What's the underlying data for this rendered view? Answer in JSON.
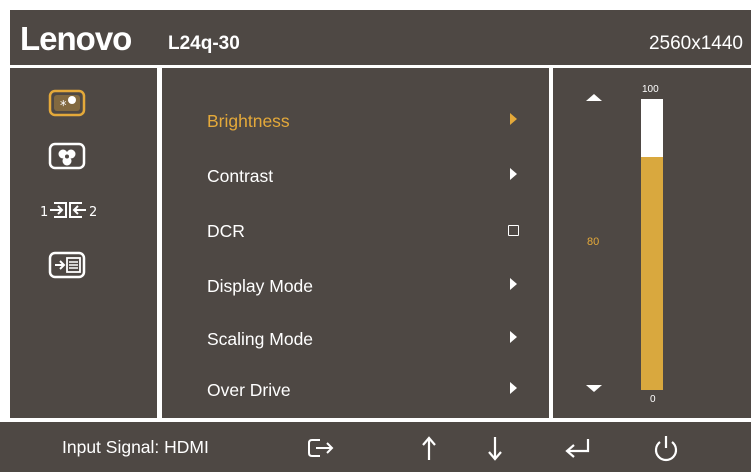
{
  "header": {
    "brand": "Lenovo",
    "model": "L24q-30",
    "resolution": "2560x1440"
  },
  "categories": [
    {
      "name": "brightness-contrast-icon",
      "active": true
    },
    {
      "name": "color-settings-icon",
      "active": false
    },
    {
      "name": "input-signal-icon",
      "active": false
    },
    {
      "name": "menu-settings-icon",
      "active": false
    }
  ],
  "menu": {
    "items": [
      {
        "label": "Brightness",
        "control": "arrow",
        "selected": true
      },
      {
        "label": "Contrast",
        "control": "arrow",
        "selected": false
      },
      {
        "label": "DCR",
        "control": "checkbox",
        "selected": false
      },
      {
        "label": "Display Mode",
        "control": "arrow",
        "selected": false
      },
      {
        "label": "Scaling Mode",
        "control": "arrow",
        "selected": false
      },
      {
        "label": "Over Drive",
        "control": "arrow",
        "selected": false
      }
    ]
  },
  "slider": {
    "max_label": "100",
    "min_label": "0",
    "current_label": "80",
    "value": 80,
    "min": 0,
    "max": 100
  },
  "footer": {
    "input_signal": "Input Signal: HDMI",
    "buttons": [
      "exit-icon",
      "up-arrow-icon",
      "down-arrow-icon",
      "enter-icon",
      "power-icon"
    ]
  },
  "colors": {
    "panel_bg": "#4e4844",
    "accent": "#e4a93a",
    "bar_fill": "#d9a83e",
    "text": "#ffffff"
  }
}
